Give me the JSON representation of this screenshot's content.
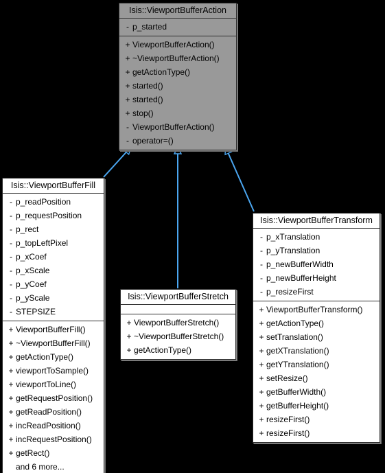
{
  "diagram": {
    "type": "uml-class-inheritance",
    "background_color": "#000000",
    "edge_color": "#4ba6f0",
    "highlight_fill": "#999999",
    "box_fill": "#ffffff",
    "border_color": "#2c2c2c",
    "relationships": [
      {
        "from": "Isis::ViewportBufferFill",
        "to": "Isis::ViewportBufferAction",
        "kind": "inheritance"
      },
      {
        "from": "Isis::ViewportBufferStretch",
        "to": "Isis::ViewportBufferAction",
        "kind": "inheritance"
      },
      {
        "from": "Isis::ViewportBufferTransform",
        "to": "Isis::ViewportBufferAction",
        "kind": "inheritance"
      }
    ]
  },
  "classes": {
    "action": {
      "name": "Isis::ViewportBufferAction",
      "attributes": [
        {
          "vis": "-",
          "name": "p_started"
        }
      ],
      "methods": [
        {
          "vis": "+",
          "name": "ViewportBufferAction()"
        },
        {
          "vis": "+",
          "name": "~ViewportBufferAction()"
        },
        {
          "vis": "+",
          "name": "getActionType()"
        },
        {
          "vis": "+",
          "name": "started()"
        },
        {
          "vis": "+",
          "name": "started()"
        },
        {
          "vis": "+",
          "name": "stop()"
        },
        {
          "vis": "-",
          "name": "ViewportBufferAction()"
        },
        {
          "vis": "-",
          "name": "operator=()"
        }
      ]
    },
    "fill": {
      "name": "Isis::ViewportBufferFill",
      "attributes": [
        {
          "vis": "-",
          "name": "p_readPosition"
        },
        {
          "vis": "-",
          "name": "p_requestPosition"
        },
        {
          "vis": "-",
          "name": "p_rect"
        },
        {
          "vis": "-",
          "name": "p_topLeftPixel"
        },
        {
          "vis": "-",
          "name": "p_xCoef"
        },
        {
          "vis": "-",
          "name": "p_xScale"
        },
        {
          "vis": "-",
          "name": "p_yCoef"
        },
        {
          "vis": "-",
          "name": "p_yScale"
        },
        {
          "vis": "-",
          "name": "STEPSIZE"
        }
      ],
      "methods": [
        {
          "vis": "+",
          "name": "ViewportBufferFill()"
        },
        {
          "vis": "+",
          "name": "~ViewportBufferFill()"
        },
        {
          "vis": "+",
          "name": "getActionType()"
        },
        {
          "vis": "+",
          "name": "viewportToSample()"
        },
        {
          "vis": "+",
          "name": "viewportToLine()"
        },
        {
          "vis": "+",
          "name": "getRequestPosition()"
        },
        {
          "vis": "+",
          "name": "getReadPosition()"
        },
        {
          "vis": "+",
          "name": "incReadPosition()"
        },
        {
          "vis": "+",
          "name": "incRequestPosition()"
        },
        {
          "vis": "+",
          "name": "getRect()"
        },
        {
          "vis": "",
          "name": "and 6 more...",
          "note": true
        }
      ]
    },
    "stretch": {
      "name": "Isis::ViewportBufferStretch",
      "attributes": [],
      "methods": [
        {
          "vis": "+",
          "name": "ViewportBufferStretch()"
        },
        {
          "vis": "+",
          "name": "~ViewportBufferStretch()"
        },
        {
          "vis": "+",
          "name": "getActionType()"
        }
      ]
    },
    "transform": {
      "name": "Isis::ViewportBufferTransform",
      "attributes": [
        {
          "vis": "-",
          "name": "p_xTranslation"
        },
        {
          "vis": "-",
          "name": "p_yTranslation"
        },
        {
          "vis": "-",
          "name": "p_newBufferWidth"
        },
        {
          "vis": "-",
          "name": "p_newBufferHeight"
        },
        {
          "vis": "-",
          "name": "p_resizeFirst"
        }
      ],
      "methods": [
        {
          "vis": "+",
          "name": "ViewportBufferTransform()"
        },
        {
          "vis": "+",
          "name": "getActionType()"
        },
        {
          "vis": "+",
          "name": "setTranslation()"
        },
        {
          "vis": "+",
          "name": "getXTranslation()"
        },
        {
          "vis": "+",
          "name": "getYTranslation()"
        },
        {
          "vis": "+",
          "name": "setResize()"
        },
        {
          "vis": "+",
          "name": "getBufferWidth()"
        },
        {
          "vis": "+",
          "name": "getBufferHeight()"
        },
        {
          "vis": "+",
          "name": "resizeFirst()"
        },
        {
          "vis": "+",
          "name": "resizeFirst()"
        }
      ]
    }
  }
}
